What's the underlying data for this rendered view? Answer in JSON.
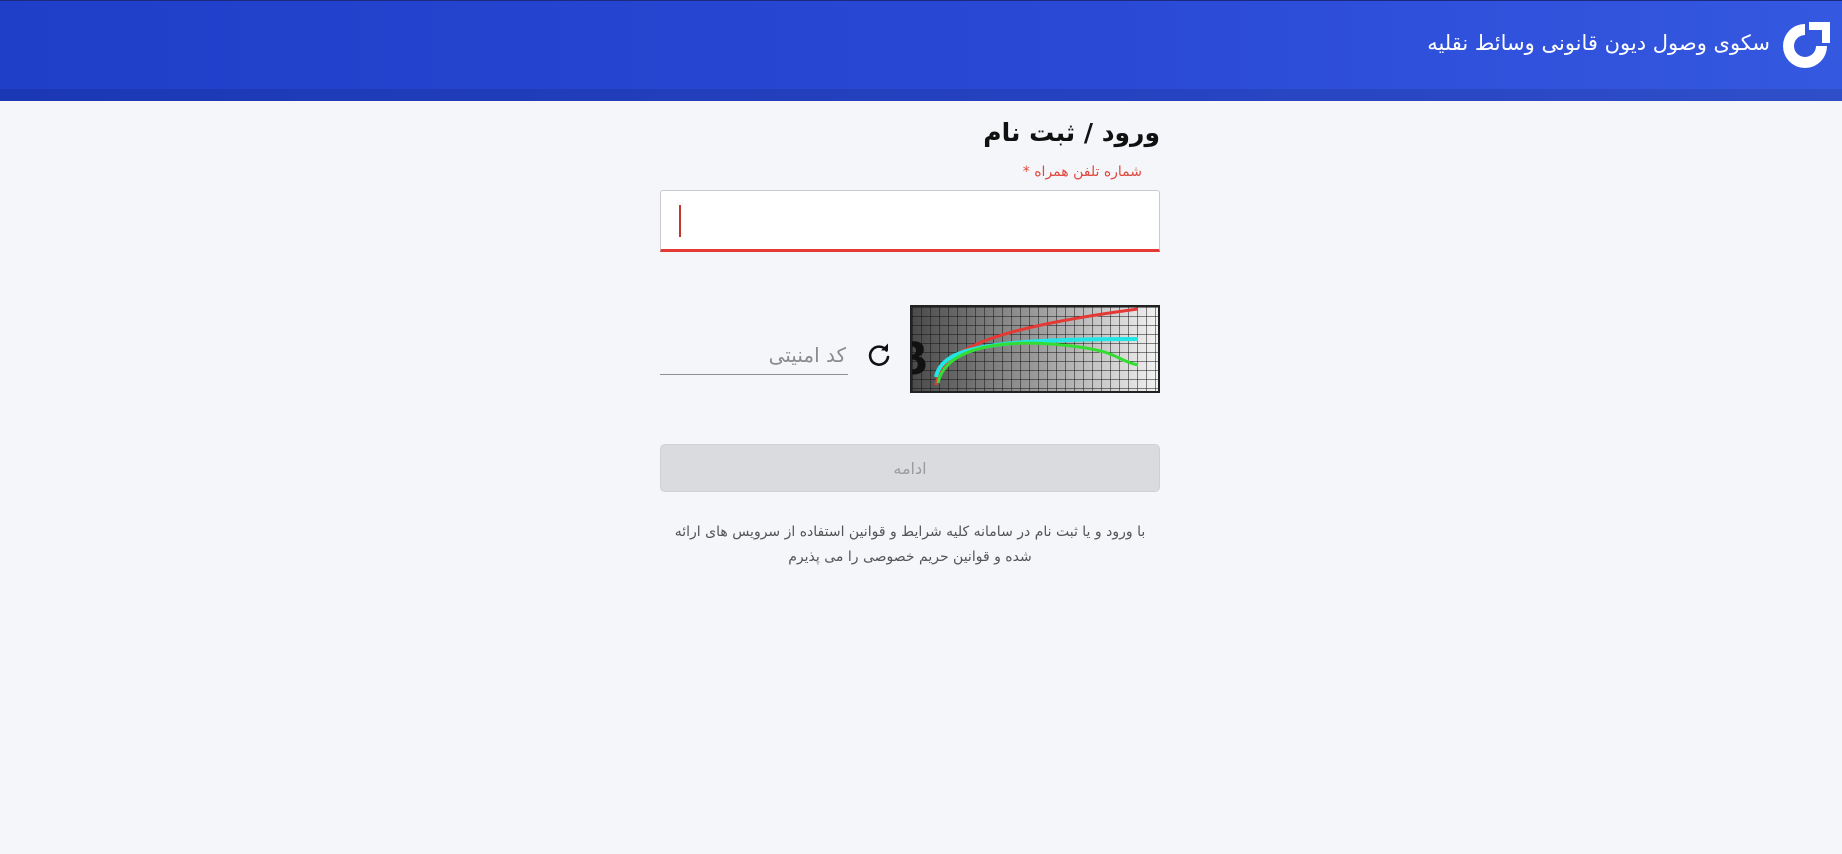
{
  "header": {
    "app_title": "سکوی وصول دیون قانونی وسائط نقلیه",
    "logo_icon": "circular-arrow-logo-icon",
    "background_color": "#2a4ad6"
  },
  "form": {
    "title": "ورود / ثبت نام",
    "phone": {
      "label": "شماره تلفن همراه *",
      "value": "",
      "accent_color": "#e53935"
    },
    "captcha": {
      "image_icon": "captcha-image",
      "refresh_icon": "refresh-icon",
      "placeholder": "کد امنیتی",
      "value": ""
    },
    "submit_label": "ادامه",
    "terms_text": "با ورود و یا ثبت نام در سامانه کلیه شرایط و قوانین استفاده از سرویس های ارائه شده و قوانین حریم خصوصی را می پذیرم"
  }
}
